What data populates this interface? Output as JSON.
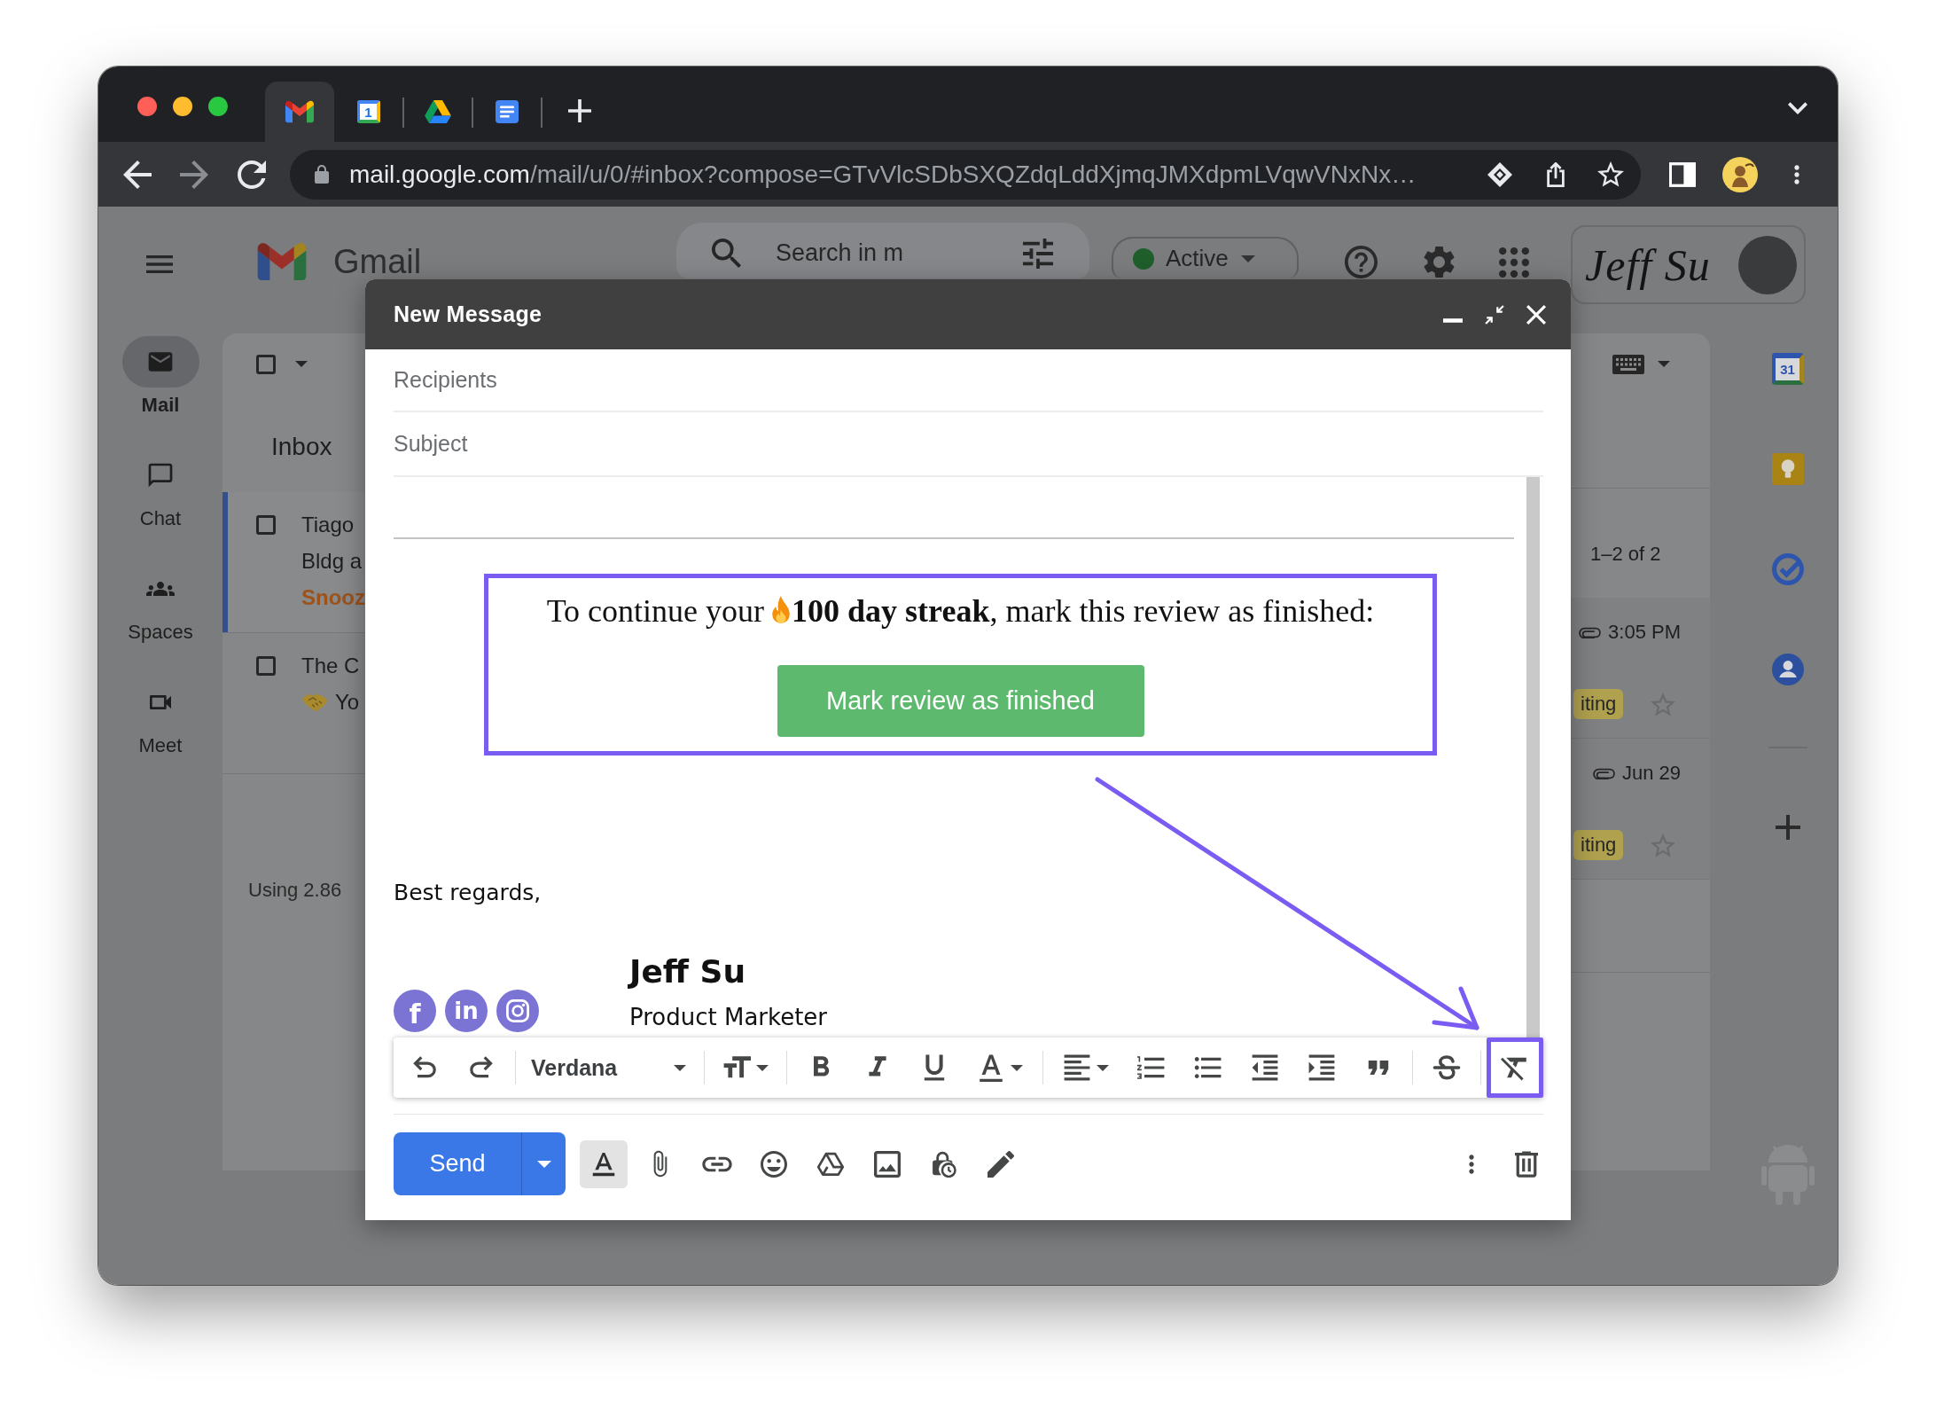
{
  "browser": {
    "tabs": [
      {
        "kind": "gmail",
        "selected": true
      },
      {
        "kind": "calendar",
        "icon_text": "1",
        "selected": false
      },
      {
        "kind": "drive",
        "selected": false
      },
      {
        "kind": "docs",
        "selected": false
      }
    ],
    "url": {
      "host": "mail.google.com",
      "path": "/mail/u/0/#inbox?compose=GTvVlcSDbSXQZdqLddXjmqJMXdpmLVqwVNxNx…"
    }
  },
  "gmail_header": {
    "logo_text": "Gmail",
    "search": {
      "placeholder": "Search in m"
    },
    "status": {
      "label": "Active"
    },
    "account": {
      "logo_text": "Jeff Su"
    }
  },
  "nav": [
    {
      "kind": "mail",
      "label": "Mail",
      "selected": true
    },
    {
      "kind": "chat",
      "label": "Chat",
      "selected": false
    },
    {
      "kind": "spaces",
      "label": "Spaces",
      "selected": false
    },
    {
      "kind": "meet",
      "label": "Meet",
      "selected": false
    }
  ],
  "list_left": {
    "select_all": {
      "checked": false
    },
    "tab": "Inbox",
    "rows": [
      {
        "selected": true,
        "checked": false,
        "sender": "Tiago",
        "subject": "Bldg a",
        "emoji": false,
        "label": "Snooz"
      },
      {
        "selected": false,
        "checked": false,
        "sender": "The C",
        "subject": "Yo",
        "emoji": true
      }
    ],
    "storage": "Using 2.86"
  },
  "list_right": {
    "count": "1–2 of 2",
    "rows": [
      {
        "attachment": true,
        "time": "3:05 PM",
        "tag": "iting",
        "starred": false
      },
      {
        "attachment": true,
        "time": "Jun 29",
        "tag": "iting",
        "starred": false
      }
    ]
  },
  "side_panel": {
    "apps": [
      {
        "kind": "calendar",
        "icon_text": "31"
      },
      {
        "kind": "keep"
      },
      {
        "kind": "tasks"
      },
      {
        "kind": "contacts"
      }
    ]
  },
  "compose": {
    "title": "New Message",
    "recipients": {
      "placeholder": "Recipients"
    },
    "subject": {
      "placeholder": "Subject"
    },
    "callout": {
      "highlighted": true,
      "text_before": "To continue your",
      "text_after": "**100 day streak**, mark this review as finished:",
      "button": "Mark review as finished"
    },
    "closing": "Best regards,",
    "signature": {
      "name": "Jeff Su",
      "title": "Product Marketer",
      "social": [
        {
          "kind": "facebook",
          "glyph": "f"
        },
        {
          "kind": "linkedin",
          "glyph": "in"
        },
        {
          "kind": "instagram"
        }
      ]
    },
    "format_toolbar": {
      "groups": [
        {
          "buttons": [
            {
              "kind": "undo",
              "highlighted": false
            },
            {
              "kind": "redo",
              "highlighted": false
            }
          ]
        },
        {
          "buttons": [
            {
              "kind": "font",
              "label": "Verdana",
              "highlighted": false
            }
          ]
        },
        {
          "buttons": [
            {
              "kind": "size",
              "highlighted": false
            }
          ]
        },
        {
          "buttons": [
            {
              "kind": "bold",
              "highlighted": false
            },
            {
              "kind": "italic",
              "highlighted": false
            },
            {
              "kind": "underline",
              "highlighted": false
            },
            {
              "kind": "text_color",
              "highlighted": false
            }
          ]
        },
        {
          "buttons": [
            {
              "kind": "align",
              "highlighted": false
            },
            {
              "kind": "numbered_list",
              "highlighted": false
            },
            {
              "kind": "bulleted_list",
              "highlighted": false
            },
            {
              "kind": "indent_less",
              "highlighted": false
            },
            {
              "kind": "indent_more",
              "highlighted": false
            },
            {
              "kind": "quote",
              "highlighted": false
            }
          ]
        },
        {
          "buttons": [
            {
              "kind": "strikethrough",
              "highlighted": false
            }
          ]
        },
        {
          "buttons": [
            {
              "kind": "remove_formatting",
              "highlighted": true
            }
          ]
        }
      ]
    },
    "send": {
      "label": "Send"
    },
    "formatting_toggle": {
      "selected": true
    }
  }
}
